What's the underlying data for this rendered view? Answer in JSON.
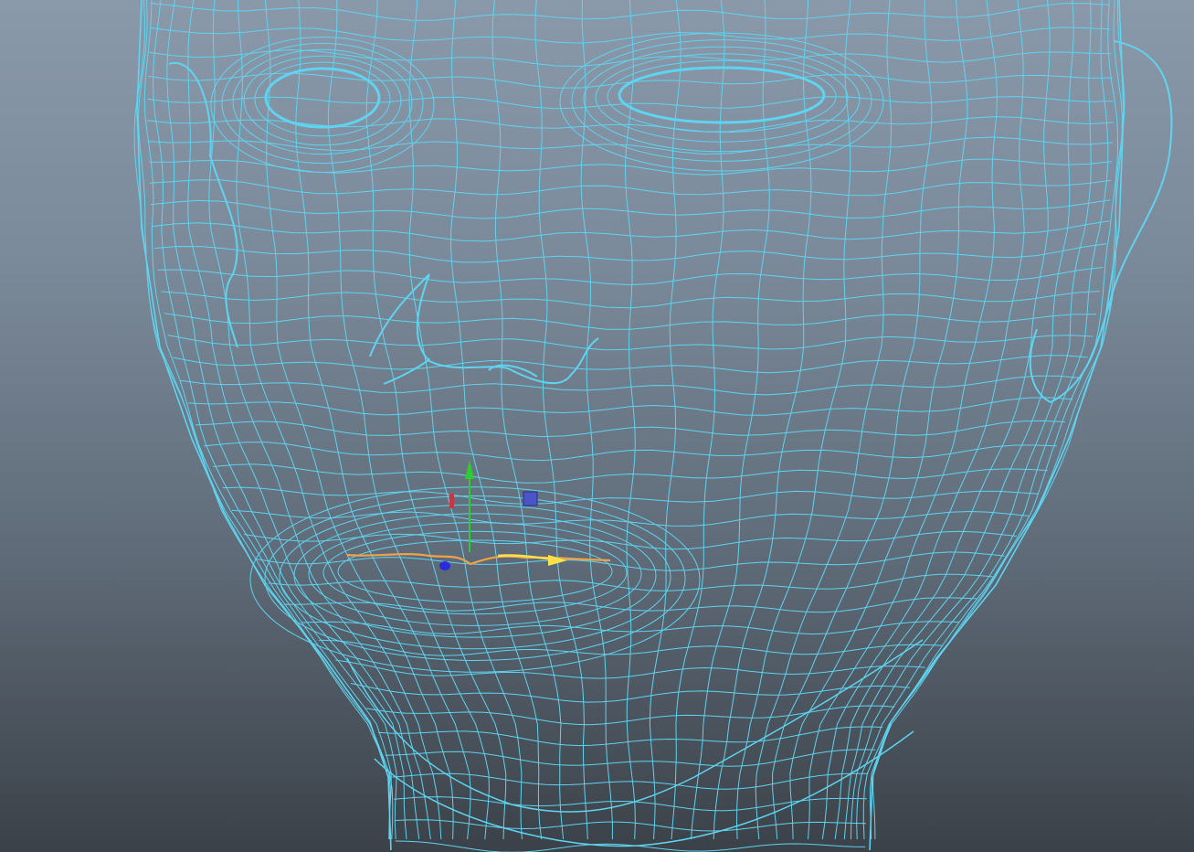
{
  "viewport": {
    "view": "front",
    "display_mode": "wireframe",
    "object": "head-mesh",
    "colors": {
      "background_top": "#8a99aa",
      "background_bottom": "#3b4148",
      "wireframe": "#5fd3ef",
      "curve": "#f0a24a",
      "curve_highlight": "#ffe04a",
      "axis_x": "#c0394b",
      "axis_y": "#2ecc2e",
      "axis_z": "#2b2bdc",
      "center_handle": "#4a55c8"
    },
    "icons": {
      "move_manipulator": "move-tool-icon"
    }
  }
}
